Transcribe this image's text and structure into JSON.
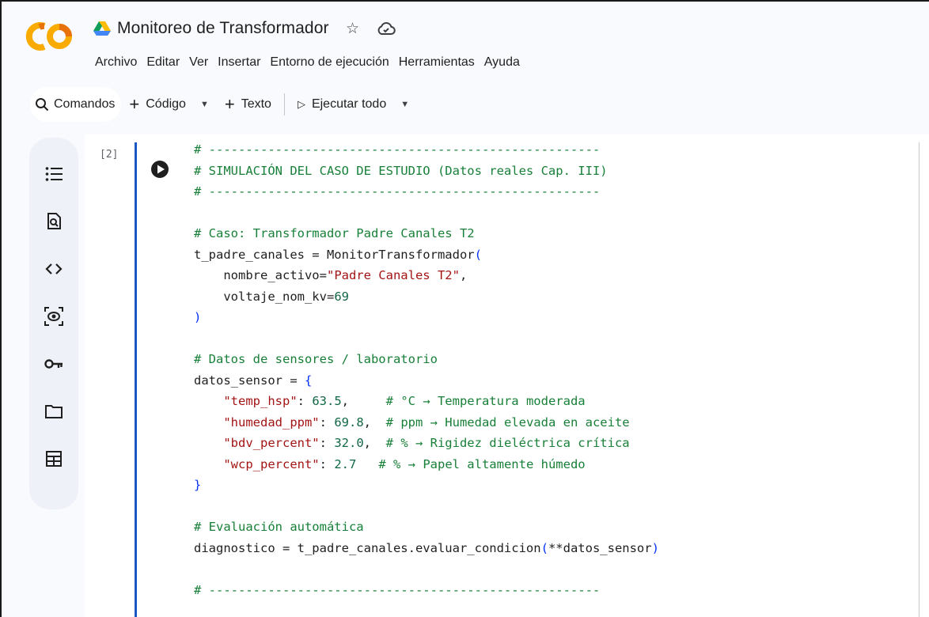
{
  "app": {
    "logo_text": "CO",
    "doc_title": "Monitoreo de Transformador",
    "title_icons": [
      "star-icon",
      "cloud-sync-icon"
    ]
  },
  "menu": {
    "items": [
      "Archivo",
      "Editar",
      "Ver",
      "Insertar",
      "Entorno de ejecución",
      "Herramientas",
      "Ayuda"
    ]
  },
  "toolbar": {
    "commands_label": "Comandos",
    "code_label": "Código",
    "text_label": "Texto",
    "run_all_label": "Ejecutar todo"
  },
  "sidebar": {
    "icons": [
      "table-of-contents-icon",
      "find-replace-icon",
      "code-snippets-icon",
      "variables-icon",
      "secrets-key-icon",
      "files-folder-icon",
      "data-table-icon"
    ]
  },
  "cell": {
    "execution_count": "[2]",
    "lines": [
      [
        {
          "t": "# -----------------------------------------------------",
          "c": "com"
        }
      ],
      [
        {
          "t": "# SIMULACIÓN DEL CASO DE ESTUDIO (Datos reales Cap. III)",
          "c": "com"
        }
      ],
      [
        {
          "t": "# -----------------------------------------------------",
          "c": "com"
        }
      ],
      [],
      [
        {
          "t": "# Caso: Transformador Padre Canales T2",
          "c": "com"
        }
      ],
      [
        {
          "t": "t_padre_canales = MonitorTransformador",
          "c": "txt"
        },
        {
          "t": "(",
          "c": "brk"
        }
      ],
      [
        {
          "t": "    nombre_activo=",
          "c": "txt"
        },
        {
          "t": "\"Padre Canales T2\"",
          "c": "str"
        },
        {
          "t": ",",
          "c": "txt"
        }
      ],
      [
        {
          "t": "    voltaje_nom_kv=",
          "c": "txt"
        },
        {
          "t": "69",
          "c": "num"
        }
      ],
      [
        {
          "t": ")",
          "c": "brk"
        }
      ],
      [],
      [
        {
          "t": "# Datos de sensores / laboratorio",
          "c": "com"
        }
      ],
      [
        {
          "t": "datos_sensor = ",
          "c": "txt"
        },
        {
          "t": "{",
          "c": "brk"
        }
      ],
      [
        {
          "t": "    ",
          "c": "txt"
        },
        {
          "t": "\"temp_hsp\"",
          "c": "str"
        },
        {
          "t": ": ",
          "c": "txt"
        },
        {
          "t": "63.5",
          "c": "num"
        },
        {
          "t": ",     ",
          "c": "txt"
        },
        {
          "t": "# °C → Temperatura moderada",
          "c": "com"
        }
      ],
      [
        {
          "t": "    ",
          "c": "txt"
        },
        {
          "t": "\"humedad_ppm\"",
          "c": "str"
        },
        {
          "t": ": ",
          "c": "txt"
        },
        {
          "t": "69.8",
          "c": "num"
        },
        {
          "t": ",  ",
          "c": "txt"
        },
        {
          "t": "# ppm → Humedad elevada en aceite",
          "c": "com"
        }
      ],
      [
        {
          "t": "    ",
          "c": "txt"
        },
        {
          "t": "\"bdv_percent\"",
          "c": "str"
        },
        {
          "t": ": ",
          "c": "txt"
        },
        {
          "t": "32.0",
          "c": "num"
        },
        {
          "t": ",  ",
          "c": "txt"
        },
        {
          "t": "# % → Rigidez dieléctrica crítica",
          "c": "com"
        }
      ],
      [
        {
          "t": "    ",
          "c": "txt"
        },
        {
          "t": "\"wcp_percent\"",
          "c": "str"
        },
        {
          "t": ": ",
          "c": "txt"
        },
        {
          "t": "2.7",
          "c": "num"
        },
        {
          "t": "   ",
          "c": "txt"
        },
        {
          "t": "# % → Papel altamente húmedo",
          "c": "com"
        }
      ],
      [
        {
          "t": "}",
          "c": "brk"
        }
      ],
      [],
      [
        {
          "t": "# Evaluación automática",
          "c": "com"
        }
      ],
      [
        {
          "t": "diagnostico = t_padre_canales.evaluar_condicion",
          "c": "txt"
        },
        {
          "t": "(",
          "c": "brk"
        },
        {
          "t": "**datos_sensor",
          "c": "txt"
        },
        {
          "t": ")",
          "c": "brk"
        }
      ],
      [],
      [
        {
          "t": "# -----------------------------------------------------",
          "c": "com"
        }
      ]
    ]
  }
}
